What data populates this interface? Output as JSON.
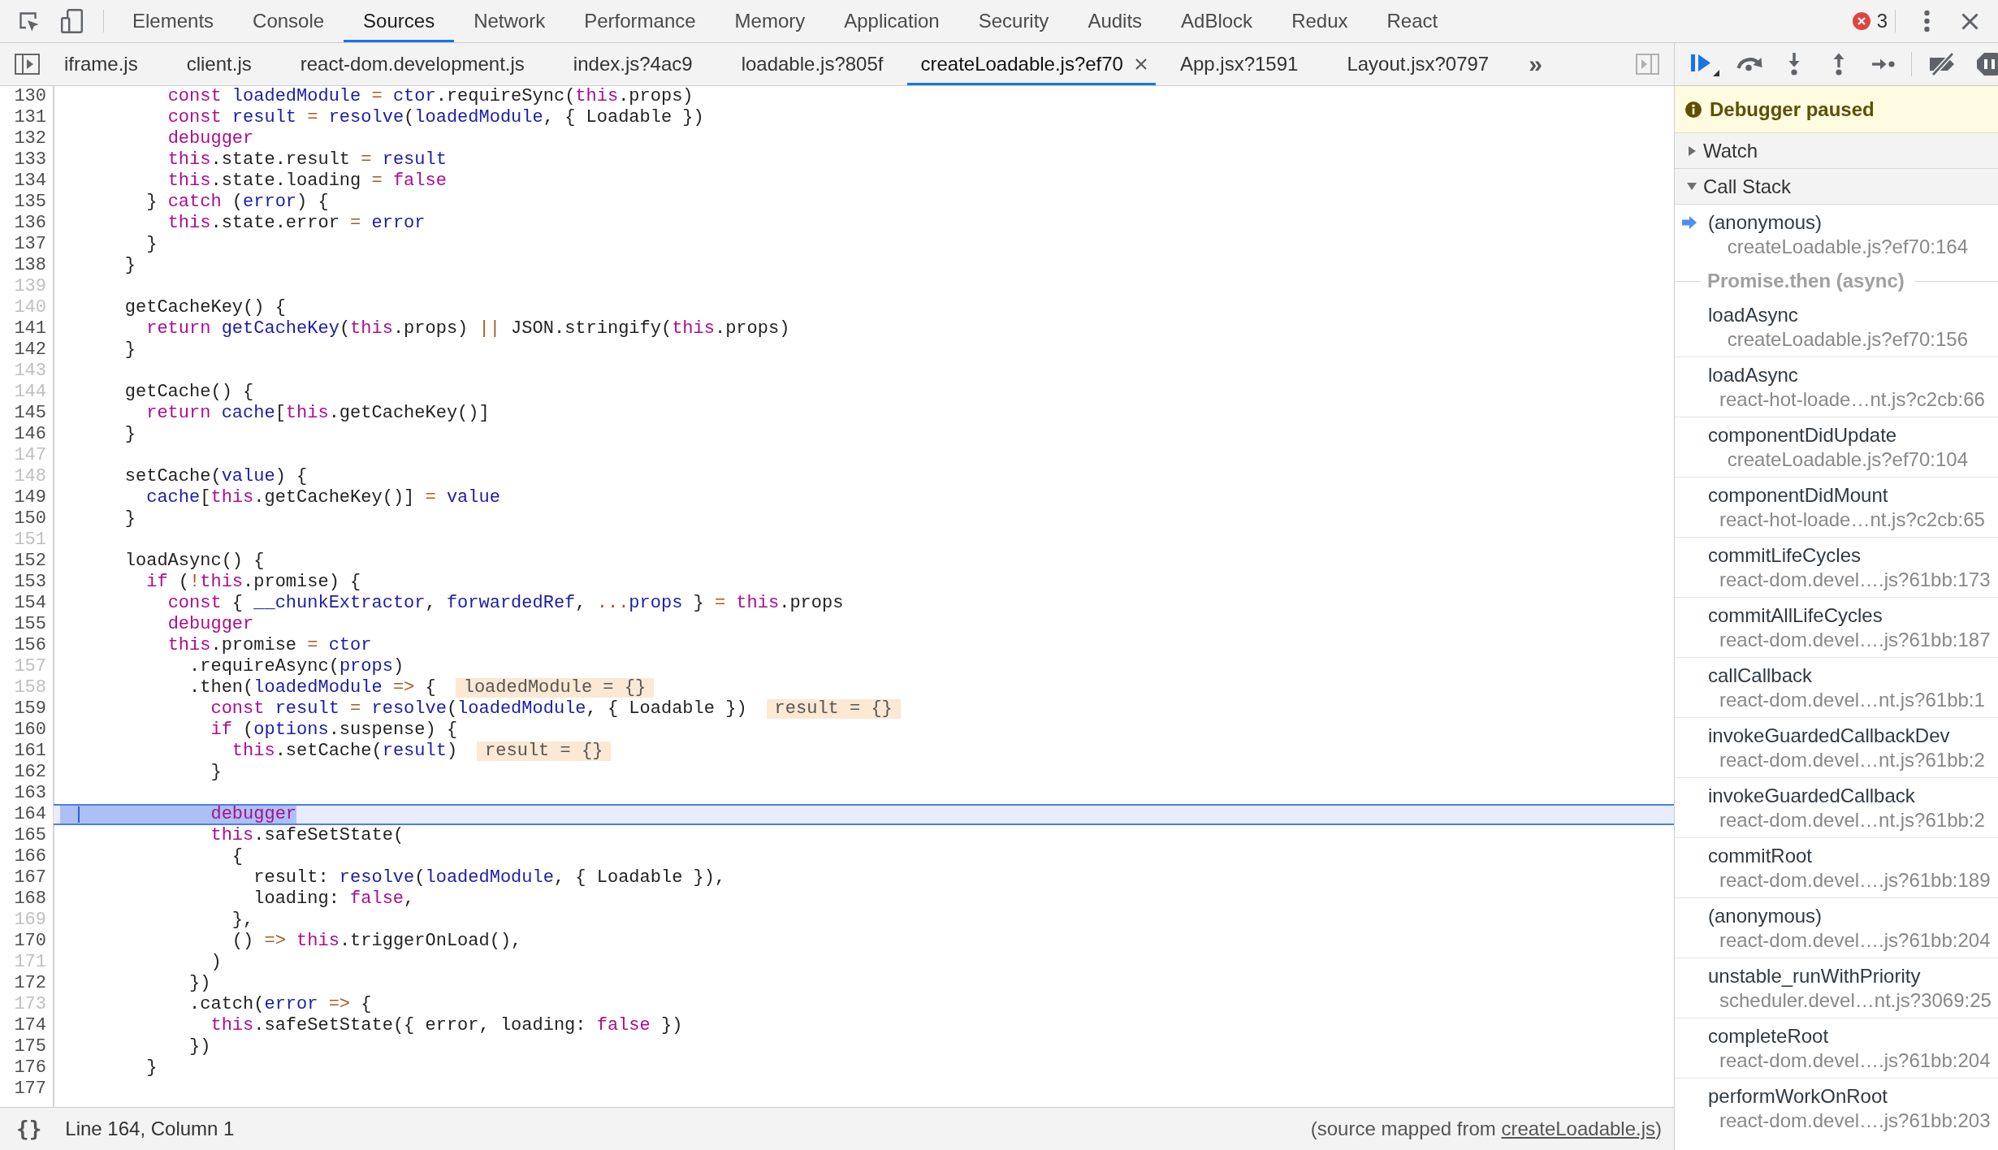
{
  "toolbar": {
    "tabs": [
      {
        "label": "Elements",
        "selected": false
      },
      {
        "label": "Console",
        "selected": false
      },
      {
        "label": "Sources",
        "selected": true
      },
      {
        "label": "Network",
        "selected": false
      },
      {
        "label": "Performance",
        "selected": false
      },
      {
        "label": "Memory",
        "selected": false
      },
      {
        "label": "Application",
        "selected": false
      },
      {
        "label": "Security",
        "selected": false
      },
      {
        "label": "Audits",
        "selected": false
      },
      {
        "label": "AdBlock",
        "selected": false
      },
      {
        "label": "Redux",
        "selected": false
      },
      {
        "label": "React",
        "selected": false
      }
    ],
    "error_count": "3"
  },
  "editor_tabs": {
    "tabs": [
      {
        "label": "iframe.js",
        "selected": false
      },
      {
        "label": "client.js",
        "selected": false
      },
      {
        "label": "react-dom.development.js",
        "selected": false
      },
      {
        "label": "index.js?4ac9",
        "selected": false
      },
      {
        "label": "loadable.js?805f",
        "selected": false
      },
      {
        "label": "createLoadable.js?ef70",
        "selected": true
      },
      {
        "label": "App.jsx?1591",
        "selected": false
      },
      {
        "label": "Layout.jsx?0797",
        "selected": false
      }
    ],
    "overflow": "»"
  },
  "code": {
    "lines": [
      {
        "number": "130",
        "dimmed": false,
        "paused": false,
        "tokens": [
          {
            "kind": "keyword",
            "text": "        const"
          },
          {
            "kind": "variable",
            "text": " loadedModule"
          },
          {
            "kind": "operator",
            "text": " ="
          },
          {
            "kind": "variable",
            "text": " ctor"
          },
          {
            "kind": "plain",
            "text": ".requireSync("
          },
          {
            "kind": "keyword",
            "text": "this"
          },
          {
            "kind": "plain",
            "text": ".props)"
          }
        ]
      },
      {
        "number": "131",
        "dimmed": false,
        "paused": false,
        "tokens": [
          {
            "kind": "keyword",
            "text": "        const"
          },
          {
            "kind": "variable",
            "text": " result"
          },
          {
            "kind": "operator",
            "text": " ="
          },
          {
            "kind": "variable",
            "text": " resolve"
          },
          {
            "kind": "plain",
            "text": "("
          },
          {
            "kind": "variable",
            "text": "loadedModule"
          },
          {
            "kind": "plain",
            "text": ", { Loadable })"
          }
        ]
      },
      {
        "number": "132",
        "dimmed": false,
        "paused": false,
        "tokens": [
          {
            "kind": "keyword",
            "text": "        debugger"
          }
        ]
      },
      {
        "number": "133",
        "dimmed": false,
        "paused": false,
        "tokens": [
          {
            "kind": "keyword",
            "text": "        this"
          },
          {
            "kind": "plain",
            "text": ".state.result "
          },
          {
            "kind": "operator",
            "text": "="
          },
          {
            "kind": "variable",
            "text": " result"
          }
        ]
      },
      {
        "number": "134",
        "dimmed": false,
        "paused": false,
        "tokens": [
          {
            "kind": "keyword",
            "text": "        this"
          },
          {
            "kind": "plain",
            "text": ".state.loading "
          },
          {
            "kind": "operator",
            "text": "="
          },
          {
            "kind": "keyword",
            "text": " false"
          }
        ]
      },
      {
        "number": "135",
        "dimmed": false,
        "paused": false,
        "tokens": [
          {
            "kind": "plain",
            "text": "      } "
          },
          {
            "kind": "keyword",
            "text": "catch"
          },
          {
            "kind": "plain",
            "text": " ("
          },
          {
            "kind": "variable",
            "text": "error"
          },
          {
            "kind": "plain",
            "text": ") {"
          }
        ]
      },
      {
        "number": "136",
        "dimmed": false,
        "paused": false,
        "tokens": [
          {
            "kind": "keyword",
            "text": "        this"
          },
          {
            "kind": "plain",
            "text": ".state.error "
          },
          {
            "kind": "operator",
            "text": "="
          },
          {
            "kind": "variable",
            "text": " error"
          }
        ]
      },
      {
        "number": "137",
        "dimmed": false,
        "paused": false,
        "tokens": [
          {
            "kind": "plain",
            "text": "      }"
          }
        ]
      },
      {
        "number": "138",
        "dimmed": false,
        "paused": false,
        "tokens": [
          {
            "kind": "plain",
            "text": "    }"
          }
        ]
      },
      {
        "number": "139",
        "dimmed": true,
        "paused": false
      },
      {
        "number": "140",
        "dimmed": true,
        "paused": false,
        "tokens": [
          {
            "kind": "plain",
            "text": "    getCacheKey() {"
          }
        ]
      },
      {
        "number": "141",
        "dimmed": false,
        "paused": false,
        "tokens": [
          {
            "kind": "keyword",
            "text": "      return"
          },
          {
            "kind": "variable",
            "text": " getCacheKey"
          },
          {
            "kind": "plain",
            "text": "("
          },
          {
            "kind": "keyword",
            "text": "this"
          },
          {
            "kind": "plain",
            "text": ".props) "
          },
          {
            "kind": "operator",
            "text": "||"
          },
          {
            "kind": "plain",
            "text": " JSON.stringify("
          },
          {
            "kind": "keyword",
            "text": "this"
          },
          {
            "kind": "plain",
            "text": ".props)"
          }
        ]
      },
      {
        "number": "142",
        "dimmed": false,
        "paused": false,
        "tokens": [
          {
            "kind": "plain",
            "text": "    }"
          }
        ]
      },
      {
        "number": "143",
        "dimmed": true,
        "paused": false
      },
      {
        "number": "144",
        "dimmed": true,
        "paused": false,
        "tokens": [
          {
            "kind": "plain",
            "text": "    getCache() {"
          }
        ]
      },
      {
        "number": "145",
        "dimmed": false,
        "paused": false,
        "tokens": [
          {
            "kind": "keyword",
            "text": "      return"
          },
          {
            "kind": "variable",
            "text": " cache"
          },
          {
            "kind": "plain",
            "text": "["
          },
          {
            "kind": "keyword",
            "text": "this"
          },
          {
            "kind": "plain",
            "text": ".getCacheKey()]"
          }
        ]
      },
      {
        "number": "146",
        "dimmed": false,
        "paused": false,
        "tokens": [
          {
            "kind": "plain",
            "text": "    }"
          }
        ]
      },
      {
        "number": "147",
        "dimmed": true,
        "paused": false
      },
      {
        "number": "148",
        "dimmed": true,
        "paused": false,
        "tokens": [
          {
            "kind": "plain",
            "text": "    setCache("
          },
          {
            "kind": "variable",
            "text": "value"
          },
          {
            "kind": "plain",
            "text": ") {"
          }
        ]
      },
      {
        "number": "149",
        "dimmed": false,
        "paused": false,
        "tokens": [
          {
            "kind": "variable",
            "text": "      cache"
          },
          {
            "kind": "plain",
            "text": "["
          },
          {
            "kind": "keyword",
            "text": "this"
          },
          {
            "kind": "plain",
            "text": ".getCacheKey()] "
          },
          {
            "kind": "operator",
            "text": "="
          },
          {
            "kind": "variable",
            "text": " value"
          }
        ]
      },
      {
        "number": "150",
        "dimmed": false,
        "paused": false,
        "tokens": [
          {
            "kind": "plain",
            "text": "    }"
          }
        ]
      },
      {
        "number": "151",
        "dimmed": true,
        "paused": false
      },
      {
        "number": "152",
        "dimmed": false,
        "paused": false,
        "tokens": [
          {
            "kind": "plain",
            "text": "    loadAsync() {"
          }
        ]
      },
      {
        "number": "153",
        "dimmed": false,
        "paused": false,
        "tokens": [
          {
            "kind": "keyword",
            "text": "      if"
          },
          {
            "kind": "plain",
            "text": " ("
          },
          {
            "kind": "operator",
            "text": "!"
          },
          {
            "kind": "keyword",
            "text": "this"
          },
          {
            "kind": "plain",
            "text": ".promise) {"
          }
        ]
      },
      {
        "number": "154",
        "dimmed": false,
        "paused": false,
        "tokens": [
          {
            "kind": "keyword",
            "text": "        const"
          },
          {
            "kind": "plain",
            "text": " { "
          },
          {
            "kind": "variable",
            "text": "__chunkExtractor"
          },
          {
            "kind": "plain",
            "text": ", "
          },
          {
            "kind": "variable",
            "text": "forwardedRef"
          },
          {
            "kind": "plain",
            "text": ", "
          },
          {
            "kind": "operator",
            "text": "..."
          },
          {
            "kind": "variable",
            "text": "props"
          },
          {
            "kind": "plain",
            "text": " } "
          },
          {
            "kind": "operator",
            "text": "="
          },
          {
            "kind": "keyword",
            "text": " this"
          },
          {
            "kind": "plain",
            "text": ".props"
          }
        ]
      },
      {
        "number": "155",
        "dimmed": false,
        "paused": false,
        "tokens": [
          {
            "kind": "keyword",
            "text": "        debugger"
          }
        ]
      },
      {
        "number": "156",
        "dimmed": false,
        "paused": false,
        "tokens": [
          {
            "kind": "keyword",
            "text": "        this"
          },
          {
            "kind": "plain",
            "text": ".promise "
          },
          {
            "kind": "operator",
            "text": "="
          },
          {
            "kind": "variable",
            "text": " ctor"
          }
        ]
      },
      {
        "number": "157",
        "dimmed": true,
        "paused": false,
        "tokens": [
          {
            "kind": "plain",
            "text": "          .requireAsync("
          },
          {
            "kind": "variable",
            "text": "props"
          },
          {
            "kind": "plain",
            "text": ")"
          }
        ]
      },
      {
        "number": "158",
        "dimmed": true,
        "paused": false,
        "tokens": [
          {
            "kind": "plain",
            "text": "          .then("
          },
          {
            "kind": "variable",
            "text": "loadedModule"
          },
          {
            "kind": "operator",
            "text": " =>"
          },
          {
            "kind": "plain",
            "text": " {"
          }
        ],
        "inline_value": "loadedModule = {}"
      },
      {
        "number": "159",
        "dimmed": false,
        "paused": false,
        "tokens": [
          {
            "kind": "keyword",
            "text": "            const"
          },
          {
            "kind": "variable",
            "text": " result"
          },
          {
            "kind": "operator",
            "text": " ="
          },
          {
            "kind": "variable",
            "text": " resolve"
          },
          {
            "kind": "plain",
            "text": "("
          },
          {
            "kind": "variable",
            "text": "loadedModule"
          },
          {
            "kind": "plain",
            "text": ", { Loadable })"
          }
        ],
        "inline_value": "result = {}"
      },
      {
        "number": "160",
        "dimmed": false,
        "paused": false,
        "tokens": [
          {
            "kind": "keyword",
            "text": "            if"
          },
          {
            "kind": "plain",
            "text": " ("
          },
          {
            "kind": "variable",
            "text": "options"
          },
          {
            "kind": "plain",
            "text": ".suspense) {"
          }
        ]
      },
      {
        "number": "161",
        "dimmed": false,
        "paused": false,
        "tokens": [
          {
            "kind": "keyword",
            "text": "              this"
          },
          {
            "kind": "plain",
            "text": ".setCache("
          },
          {
            "kind": "variable",
            "text": "result"
          },
          {
            "kind": "plain",
            "text": ")"
          }
        ],
        "inline_value": "result = {}"
      },
      {
        "number": "162",
        "dimmed": false,
        "paused": false,
        "tokens": [
          {
            "kind": "plain",
            "text": "            }"
          }
        ]
      },
      {
        "number": "163",
        "dimmed": false,
        "paused": false
      },
      {
        "number": "164",
        "dimmed": false,
        "paused": true,
        "tokens": [
          {
            "kind": "keyword",
            "text": "            debugger"
          }
        ]
      },
      {
        "number": "165",
        "dimmed": false,
        "paused": false,
        "tokens": [
          {
            "kind": "keyword",
            "text": "            this"
          },
          {
            "kind": "plain",
            "text": ".safeSetState("
          }
        ]
      },
      {
        "number": "166",
        "dimmed": false,
        "paused": false,
        "tokens": [
          {
            "kind": "plain",
            "text": "              {"
          }
        ]
      },
      {
        "number": "167",
        "dimmed": false,
        "paused": false,
        "tokens": [
          {
            "kind": "plain",
            "text": "                result: "
          },
          {
            "kind": "variable",
            "text": "resolve"
          },
          {
            "kind": "plain",
            "text": "("
          },
          {
            "kind": "variable",
            "text": "loadedModule"
          },
          {
            "kind": "plain",
            "text": ", { Loadable }),"
          }
        ]
      },
      {
        "number": "168",
        "dimmed": false,
        "paused": false,
        "tokens": [
          {
            "kind": "plain",
            "text": "                loading: "
          },
          {
            "kind": "keyword",
            "text": "false"
          },
          {
            "kind": "plain",
            "text": ","
          }
        ]
      },
      {
        "number": "169",
        "dimmed": true,
        "paused": false,
        "tokens": [
          {
            "kind": "plain",
            "text": "              },"
          }
        ]
      },
      {
        "number": "170",
        "dimmed": false,
        "paused": false,
        "tokens": [
          {
            "kind": "plain",
            "text": "              () "
          },
          {
            "kind": "operator",
            "text": "=>"
          },
          {
            "kind": "keyword",
            "text": " this"
          },
          {
            "kind": "plain",
            "text": ".triggerOnLoad(),"
          }
        ]
      },
      {
        "number": "171",
        "dimmed": true,
        "paused": false,
        "tokens": [
          {
            "kind": "plain",
            "text": "            )"
          }
        ]
      },
      {
        "number": "172",
        "dimmed": false,
        "paused": false,
        "tokens": [
          {
            "kind": "plain",
            "text": "          })"
          }
        ]
      },
      {
        "number": "173",
        "dimmed": true,
        "paused": false,
        "tokens": [
          {
            "kind": "plain",
            "text": "          .catch("
          },
          {
            "kind": "variable",
            "text": "error"
          },
          {
            "kind": "operator",
            "text": " =>"
          },
          {
            "kind": "plain",
            "text": " {"
          }
        ]
      },
      {
        "number": "174",
        "dimmed": false,
        "paused": false,
        "tokens": [
          {
            "kind": "keyword",
            "text": "            this"
          },
          {
            "kind": "plain",
            "text": ".safeSetState({ error, loading: "
          },
          {
            "kind": "keyword",
            "text": "false"
          },
          {
            "kind": "plain",
            "text": " })"
          }
        ]
      },
      {
        "number": "175",
        "dimmed": false,
        "paused": false,
        "tokens": [
          {
            "kind": "plain",
            "text": "          })"
          }
        ]
      },
      {
        "number": "176",
        "dimmed": false,
        "paused": false,
        "tokens": [
          {
            "kind": "plain",
            "text": "      }"
          }
        ]
      },
      {
        "number": "177",
        "dimmed": false,
        "paused": false
      }
    ]
  },
  "status_bar": {
    "format_button": "{}",
    "cursor_position": "Line 164, Column 1",
    "source_note": {
      "prefix": "(source mapped from ",
      "link": "createLoadable.js",
      "suffix": ")"
    }
  },
  "debugger": {
    "banner": "Debugger paused",
    "sections": [
      {
        "title": "Watch",
        "expanded": false
      },
      {
        "title": "Call Stack",
        "expanded": true,
        "frames": [
          {
            "kind": "frame",
            "name": "(anonymous)",
            "location": "createLoadable.js?ef70:164",
            "selected": true
          },
          {
            "kind": "async",
            "label": "Promise.then (async)"
          },
          {
            "kind": "frame",
            "name": "loadAsync",
            "location": "createLoadable.js?ef70:156",
            "selected": false
          },
          {
            "kind": "frame",
            "name": "loadAsync",
            "location": "react-hot-loade…nt.js?c2cb:66",
            "selected": false
          },
          {
            "kind": "frame",
            "name": "componentDidUpdate",
            "location": "createLoadable.js?ef70:104",
            "selected": false
          },
          {
            "kind": "frame",
            "name": "componentDidMount",
            "location": "react-hot-loade…nt.js?c2cb:65",
            "selected": false
          },
          {
            "kind": "frame",
            "name": "commitLifeCycles",
            "location": "react-dom.devel….js?61bb:173",
            "selected": false
          },
          {
            "kind": "frame",
            "name": "commitAllLifeCycles",
            "location": "react-dom.devel….js?61bb:187",
            "selected": false
          },
          {
            "kind": "frame",
            "name": "callCallback",
            "location": "react-dom.devel…nt.js?61bb:1",
            "selected": false
          },
          {
            "kind": "frame",
            "name": "invokeGuardedCallbackDev",
            "location": "react-dom.devel…nt.js?61bb:2",
            "selected": false
          },
          {
            "kind": "frame",
            "name": "invokeGuardedCallback",
            "location": "react-dom.devel…nt.js?61bb:2",
            "selected": false
          },
          {
            "kind": "frame",
            "name": "commitRoot",
            "location": "react-dom.devel….js?61bb:189",
            "selected": false
          },
          {
            "kind": "frame",
            "name": "(anonymous)",
            "location": "react-dom.devel….js?61bb:204",
            "selected": false
          },
          {
            "kind": "frame",
            "name": "unstable_runWithPriority",
            "location": "scheduler.devel…nt.js?3069:25",
            "selected": false
          },
          {
            "kind": "frame",
            "name": "completeRoot",
            "location": "react-dom.devel….js?61bb:204",
            "selected": false
          },
          {
            "kind": "frame",
            "name": "performWorkOnRoot",
            "location": "react-dom.devel….js?61bb:203",
            "selected": false
          }
        ]
      }
    ]
  }
}
